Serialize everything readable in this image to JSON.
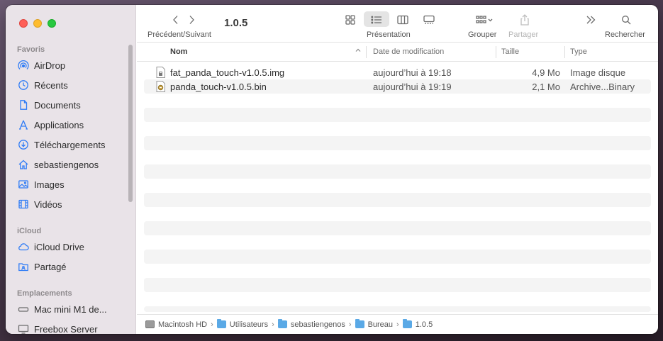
{
  "window": {
    "title": "1.0.5"
  },
  "toolbar": {
    "nav_label": "Précédent/Suivant",
    "view_label": "Présentation",
    "group_label": "Grouper",
    "share_label": "Partager",
    "search_label": "Rechercher"
  },
  "sidebar": {
    "favorites_title": "Favoris",
    "favorites": [
      {
        "label": "AirDrop",
        "icon": "airdrop-icon"
      },
      {
        "label": "Récents",
        "icon": "clock-icon"
      },
      {
        "label": "Documents",
        "icon": "document-icon"
      },
      {
        "label": "Applications",
        "icon": "applications-icon"
      },
      {
        "label": "Téléchargements",
        "icon": "download-icon"
      },
      {
        "label": "sebastiengenos",
        "icon": "home-icon"
      },
      {
        "label": "Images",
        "icon": "photo-icon"
      },
      {
        "label": "Vidéos",
        "icon": "film-icon"
      }
    ],
    "icloud_title": "iCloud",
    "icloud": [
      {
        "label": "iCloud Drive",
        "icon": "cloud-icon"
      },
      {
        "label": "Partagé",
        "icon": "shared-folder-icon"
      }
    ],
    "locations_title": "Emplacements",
    "locations": [
      {
        "label": "Mac mini M1 de...",
        "icon": "computer-icon"
      },
      {
        "label": "Freebox Server",
        "icon": "display-icon"
      }
    ]
  },
  "columns": {
    "name": "Nom",
    "date": "Date de modification",
    "size": "Taille",
    "type": "Type"
  },
  "files": [
    {
      "name": "fat_panda_touch-v1.0.5.img",
      "date": "aujourd’hui à 19:18",
      "size": "4,9 Mo",
      "type": "Image disque"
    },
    {
      "name": "panda_touch-v1.0.5.bin",
      "date": "aujourd’hui à 19:19",
      "size": "2,1 Mo",
      "type": "Archive...Binary"
    }
  ],
  "pathbar": [
    {
      "label": "Macintosh HD",
      "icon": "hard-drive-icon"
    },
    {
      "label": "Utilisateurs",
      "icon": "folder-icon"
    },
    {
      "label": "sebastiengenos",
      "icon": "home-folder-icon"
    },
    {
      "label": "Bureau",
      "icon": "folder-icon"
    },
    {
      "label": "1.0.5",
      "icon": "folder-icon"
    }
  ],
  "colors": {
    "accent": "#2f7cf6",
    "sidebar_bg": "#e9e3e8",
    "folder": "#5aa9e6"
  }
}
